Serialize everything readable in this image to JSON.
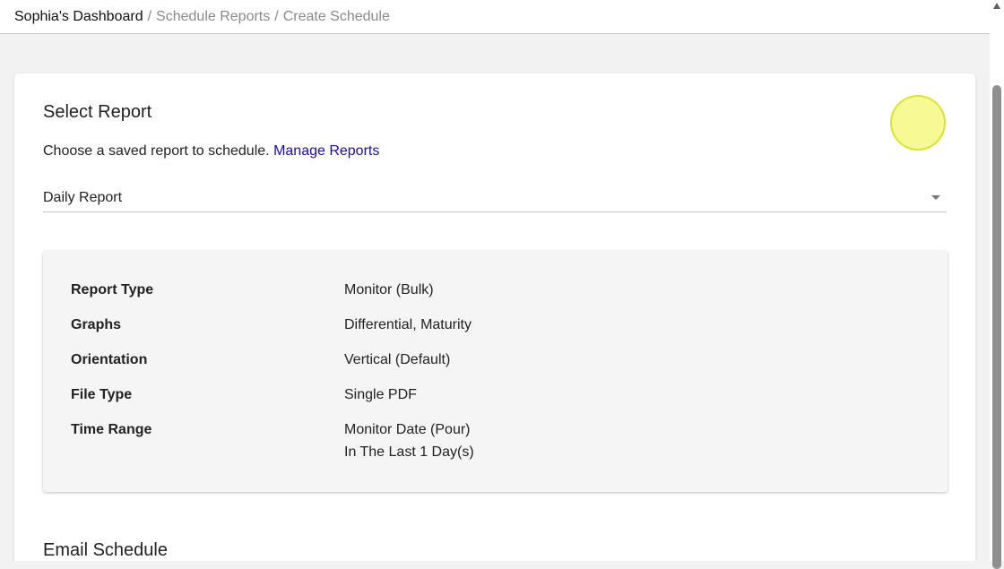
{
  "breadcrumb": {
    "root": "Sophia's Dashboard",
    "separator": "/",
    "items": [
      "Schedule Reports",
      "Create Schedule"
    ]
  },
  "select_report": {
    "title": "Select Report",
    "description": "Choose a saved report to schedule.",
    "manage_link": "Manage Reports",
    "selected_report": "Daily Report"
  },
  "details": [
    {
      "label": "Report Type",
      "value": "Monitor (Bulk)"
    },
    {
      "label": "Graphs",
      "value": "Differential, Maturity"
    },
    {
      "label": "Orientation",
      "value": "Vertical (Default)"
    },
    {
      "label": "File Type",
      "value": "Single PDF"
    },
    {
      "label": "Time Range",
      "value": "Monitor Date (Pour)",
      "value_line2": "In The Last 1 Day(s)"
    }
  ],
  "email_schedule": {
    "title": "Email Schedule"
  },
  "colors": {
    "link": "#1a0dab",
    "highlight": "#f0f53c",
    "background": "#f2f2f2"
  },
  "icons": {
    "dropdown": "chevron-down-icon",
    "scroll_up": "arrow-up-icon"
  }
}
